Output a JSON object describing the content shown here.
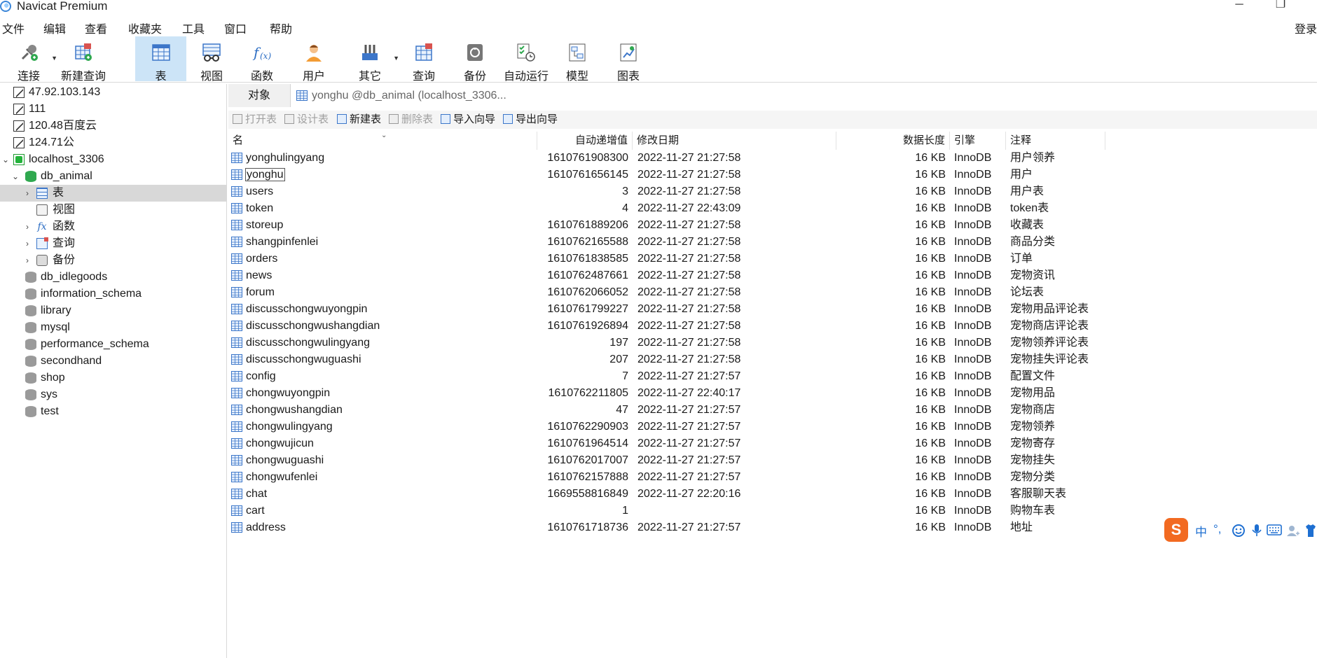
{
  "window": {
    "title": "Navicat Premium",
    "minimize": "─",
    "restore": "❐"
  },
  "menu": [
    "文件",
    "编辑",
    "查看",
    "收藏夹",
    "工具",
    "窗口",
    "帮助"
  ],
  "login": "登录",
  "toolbar": [
    {
      "label": "连接",
      "icon": "connect-icon"
    },
    {
      "label": "新建查询",
      "icon": "new-query-icon"
    },
    {
      "label": "表",
      "icon": "table-icon"
    },
    {
      "label": "视图",
      "icon": "view-icon"
    },
    {
      "label": "函数",
      "icon": "function-icon"
    },
    {
      "label": "用户",
      "icon": "user-icon"
    },
    {
      "label": "其它",
      "icon": "tools-icon"
    },
    {
      "label": "查询",
      "icon": "query-icon"
    },
    {
      "label": "备份",
      "icon": "backup-icon"
    },
    {
      "label": "自动运行",
      "icon": "automation-icon"
    },
    {
      "label": "模型",
      "icon": "model-icon"
    },
    {
      "label": "图表",
      "icon": "chart-icon"
    }
  ],
  "sidebar": {
    "connections": [
      "47.92.103.143",
      "111",
      "120.48百度云",
      "124.71公",
      "localhost_3306"
    ],
    "db_animal": "db_animal",
    "children": [
      "表",
      "视图",
      "函数",
      "查询",
      "备份"
    ],
    "databases": [
      "db_idlegoods",
      "information_schema",
      "library",
      "mysql",
      "performance_schema",
      "secondhand",
      "shop",
      "sys",
      "test"
    ]
  },
  "tabs": {
    "objects": "对象",
    "document": "yonghu @db_animal (localhost_3306..."
  },
  "actions": [
    {
      "label": "打开表",
      "enabled": false
    },
    {
      "label": "设计表",
      "enabled": false
    },
    {
      "label": "新建表",
      "enabled": true
    },
    {
      "label": "删除表",
      "enabled": false
    },
    {
      "label": "导入向导",
      "enabled": true
    },
    {
      "label": "导出向导",
      "enabled": true
    }
  ],
  "columns": {
    "name": "名",
    "auto_inc": "自动递增值",
    "modified": "修改日期",
    "size": "数据长度",
    "engine": "引擎",
    "comment": "注释"
  },
  "rows": [
    {
      "name": "yonghulingyang",
      "auto_inc": "1610761908300",
      "modified": "2022-11-27 21:27:58",
      "size": "16 KB",
      "engine": "InnoDB",
      "comment": "用户领养"
    },
    {
      "name": "yonghu",
      "auto_inc": "1610761656145",
      "modified": "2022-11-27 21:27:58",
      "size": "16 KB",
      "engine": "InnoDB",
      "comment": "用户"
    },
    {
      "name": "users",
      "auto_inc": "3",
      "modified": "2022-11-27 21:27:58",
      "size": "16 KB",
      "engine": "InnoDB",
      "comment": "用户表"
    },
    {
      "name": "token",
      "auto_inc": "4",
      "modified": "2022-11-27 22:43:09",
      "size": "16 KB",
      "engine": "InnoDB",
      "comment": "token表"
    },
    {
      "name": "storeup",
      "auto_inc": "1610761889206",
      "modified": "2022-11-27 21:27:58",
      "size": "16 KB",
      "engine": "InnoDB",
      "comment": "收藏表"
    },
    {
      "name": "shangpinfenlei",
      "auto_inc": "1610762165588",
      "modified": "2022-11-27 21:27:58",
      "size": "16 KB",
      "engine": "InnoDB",
      "comment": "商品分类"
    },
    {
      "name": "orders",
      "auto_inc": "1610761838585",
      "modified": "2022-11-27 21:27:58",
      "size": "16 KB",
      "engine": "InnoDB",
      "comment": "订单"
    },
    {
      "name": "news",
      "auto_inc": "1610762487661",
      "modified": "2022-11-27 21:27:58",
      "size": "16 KB",
      "engine": "InnoDB",
      "comment": "宠物资讯"
    },
    {
      "name": "forum",
      "auto_inc": "1610762066052",
      "modified": "2022-11-27 21:27:58",
      "size": "16 KB",
      "engine": "InnoDB",
      "comment": "论坛表"
    },
    {
      "name": "discusschongwuyongpin",
      "auto_inc": "1610761799227",
      "modified": "2022-11-27 21:27:58",
      "size": "16 KB",
      "engine": "InnoDB",
      "comment": "宠物用品评论表"
    },
    {
      "name": "discusschongwushangdian",
      "auto_inc": "1610761926894",
      "modified": "2022-11-27 21:27:58",
      "size": "16 KB",
      "engine": "InnoDB",
      "comment": "宠物商店评论表"
    },
    {
      "name": "discusschongwulingyang",
      "auto_inc": "197",
      "modified": "2022-11-27 21:27:58",
      "size": "16 KB",
      "engine": "InnoDB",
      "comment": "宠物领养评论表"
    },
    {
      "name": "discusschongwuguashi",
      "auto_inc": "207",
      "modified": "2022-11-27 21:27:58",
      "size": "16 KB",
      "engine": "InnoDB",
      "comment": "宠物挂失评论表"
    },
    {
      "name": "config",
      "auto_inc": "7",
      "modified": "2022-11-27 21:27:57",
      "size": "16 KB",
      "engine": "InnoDB",
      "comment": "配置文件"
    },
    {
      "name": "chongwuyongpin",
      "auto_inc": "1610762211805",
      "modified": "2022-11-27 22:40:17",
      "size": "16 KB",
      "engine": "InnoDB",
      "comment": "宠物用品"
    },
    {
      "name": "chongwushangdian",
      "auto_inc": "47",
      "modified": "2022-11-27 21:27:57",
      "size": "16 KB",
      "engine": "InnoDB",
      "comment": "宠物商店"
    },
    {
      "name": "chongwulingyang",
      "auto_inc": "1610762290903",
      "modified": "2022-11-27 21:27:57",
      "size": "16 KB",
      "engine": "InnoDB",
      "comment": "宠物领养"
    },
    {
      "name": "chongwujicun",
      "auto_inc": "1610761964514",
      "modified": "2022-11-27 21:27:57",
      "size": "16 KB",
      "engine": "InnoDB",
      "comment": "宠物寄存"
    },
    {
      "name": "chongwuguashi",
      "auto_inc": "1610762017007",
      "modified": "2022-11-27 21:27:57",
      "size": "16 KB",
      "engine": "InnoDB",
      "comment": "宠物挂失"
    },
    {
      "name": "chongwufenlei",
      "auto_inc": "1610762157888",
      "modified": "2022-11-27 21:27:57",
      "size": "16 KB",
      "engine": "InnoDB",
      "comment": "宠物分类"
    },
    {
      "name": "chat",
      "auto_inc": "1669558816849",
      "modified": "2022-11-27 22:20:16",
      "size": "16 KB",
      "engine": "InnoDB",
      "comment": "客服聊天表"
    },
    {
      "name": "cart",
      "auto_inc": "1",
      "modified": "",
      "size": "16 KB",
      "engine": "InnoDB",
      "comment": "购物车表"
    },
    {
      "name": "address",
      "auto_inc": "1610761718736",
      "modified": "2022-11-27 21:27:57",
      "size": "16 KB",
      "engine": "InnoDB",
      "comment": "地址"
    }
  ],
  "ime": {
    "logo": "S",
    "lang": "中",
    "punct": "°,"
  },
  "colors": {
    "accent": "#cce4f7",
    "table_icon": "#3c76c9",
    "selection": "#d8d8d8",
    "ime": "#f26a21"
  }
}
